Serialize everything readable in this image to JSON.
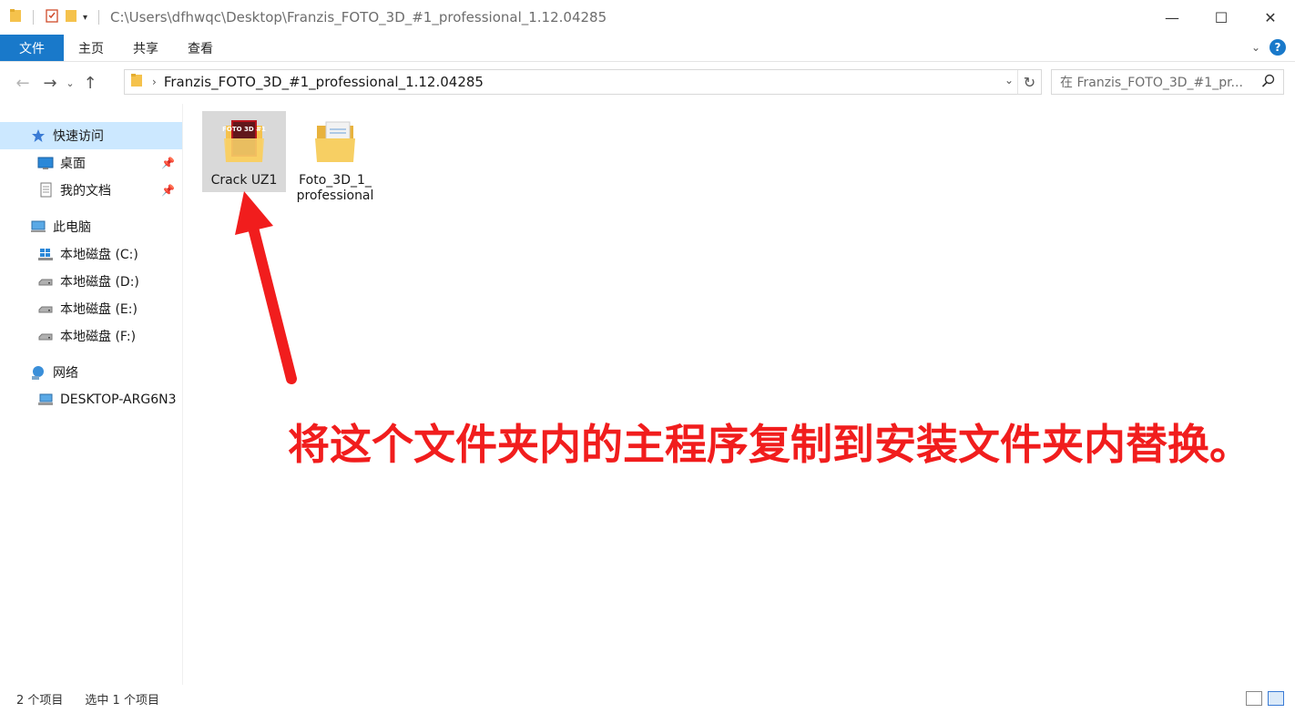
{
  "titlebar": {
    "path": "C:\\Users\\dfhwqc\\Desktop\\Franzis_FOTO_3D_#1_professional_1.12.04285",
    "minimize": "—",
    "maximize": "☐",
    "close": "✕"
  },
  "ribbon": {
    "tabs": [
      {
        "label": "文件"
      },
      {
        "label": "主页"
      },
      {
        "label": "共享"
      },
      {
        "label": "查看"
      }
    ]
  },
  "address": {
    "segment": "Franzis_FOTO_3D_#1_professional_1.12.04285",
    "search_placeholder": "在 Franzis_FOTO_3D_#1_pr..."
  },
  "sidebar": {
    "items": [
      {
        "label": "快速访问",
        "icon": "star-icon"
      },
      {
        "label": "桌面",
        "icon": "desktop-icon"
      },
      {
        "label": "我的文档",
        "icon": "documents-icon"
      },
      {
        "label": "此电脑",
        "icon": "computer-icon"
      },
      {
        "label": "本地磁盘 (C:)",
        "icon": "windows-drive-icon"
      },
      {
        "label": "本地磁盘 (D:)",
        "icon": "drive-icon"
      },
      {
        "label": "本地磁盘 (E:)",
        "icon": "drive-icon"
      },
      {
        "label": "本地磁盘 (F:)",
        "icon": "drive-icon"
      },
      {
        "label": "网络",
        "icon": "network-icon"
      },
      {
        "label": "DESKTOP-ARG6N3",
        "icon": "network-computer-icon"
      }
    ]
  },
  "files": [
    {
      "name": "Crack UZ1",
      "icon": "folder-with-image-icon",
      "thumb_text": "FOTO 3D #1"
    },
    {
      "name": "Foto_3D_1_professional",
      "icon": "folder-with-document-icon"
    }
  ],
  "annotation": {
    "text": "将这个文件夹内的主程序复制到安装文件夹内替换。",
    "color": "#f11d1d"
  },
  "statusbar": {
    "count": "2 个项目",
    "selected": "选中 1 个项目"
  },
  "colors": {
    "accent": "#1979ca",
    "selection": "#cce8ff",
    "folder": "#f5c24c"
  }
}
